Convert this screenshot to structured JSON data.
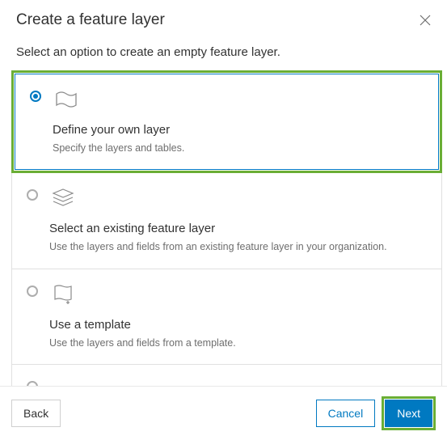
{
  "header": {
    "title": "Create a feature layer"
  },
  "subtitle": "Select an option to create an empty feature layer.",
  "options": [
    {
      "title": "Define your own layer",
      "desc": "Specify the layers and tables.",
      "selected": true,
      "highlighted": true,
      "icon": "define-layer-icon"
    },
    {
      "title": "Select an existing feature layer",
      "desc": "Use the layers and fields from an existing feature layer in your organization.",
      "selected": false,
      "highlighted": false,
      "icon": "layers-icon"
    },
    {
      "title": "Use a template",
      "desc": "Use the layers and fields from a template.",
      "selected": false,
      "highlighted": false,
      "icon": "template-icon"
    }
  ],
  "footer": {
    "back": "Back",
    "cancel": "Cancel",
    "next": "Next"
  }
}
